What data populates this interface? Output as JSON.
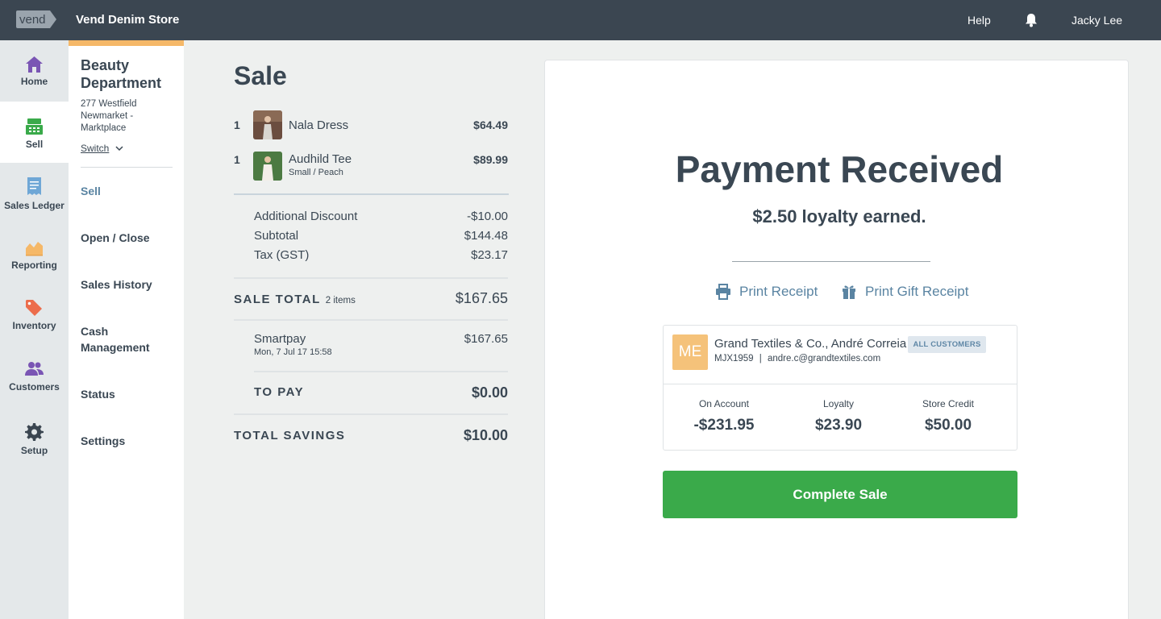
{
  "topbar": {
    "logo_text": "vend",
    "store_name": "Vend Denim Store",
    "help_label": "Help",
    "user_name": "Jacky Lee"
  },
  "nav": {
    "items": [
      {
        "label": "Home",
        "icon": "home-icon",
        "color": "#7a55b4"
      },
      {
        "label": "Sell",
        "icon": "register-icon",
        "color": "#3aaa4a"
      },
      {
        "label": "Sales Ledger",
        "icon": "ledger-icon",
        "color": "#6fa7d6"
      },
      {
        "label": "Reporting",
        "icon": "chart-icon",
        "color": "#f5b868"
      },
      {
        "label": "Inventory",
        "icon": "tag-icon",
        "color": "#ec6d4c"
      },
      {
        "label": "Customers",
        "icon": "people-icon",
        "color": "#7a55b4"
      },
      {
        "label": "Setup",
        "icon": "gear-icon",
        "color": "#3b4651"
      }
    ]
  },
  "dept": {
    "title": "Beauty Department",
    "address": "277 Westfield Newmarket - Marktplace",
    "switch_label": "Switch",
    "menu": [
      "Sell",
      "Open / Close",
      "Sales History",
      "Cash Management",
      "Status",
      "Settings"
    ]
  },
  "sale": {
    "title": "Sale",
    "items": [
      {
        "qty": "1",
        "name": "Nala Dress",
        "variant": "",
        "price": "$64.49"
      },
      {
        "qty": "1",
        "name": "Audhild Tee",
        "variant": "Small / Peach",
        "price": "$89.99"
      }
    ],
    "discount_label": "Additional Discount",
    "discount_value": "-$10.00",
    "subtotal_label": "Subtotal",
    "subtotal_value": "$144.48",
    "tax_label": "Tax (GST)",
    "tax_value": "$23.17",
    "total_label": "SALE TOTAL",
    "total_items": "2 items",
    "total_value": "$167.65",
    "payment_method": "Smartpay",
    "payment_date": "Mon, 7 Jul 17 15:58",
    "payment_value": "$167.65",
    "to_pay_label": "TO PAY",
    "to_pay_value": "$0.00",
    "savings_label": "TOTAL SAVINGS",
    "savings_value": "$10.00"
  },
  "payment": {
    "title": "Payment Received",
    "loyalty_earned": "$2.50 loyalty earned.",
    "print_receipt": "Print Receipt",
    "print_gift_receipt": "Print Gift Receipt",
    "complete_label": "Complete Sale",
    "accent_color": "#3aaa4a",
    "link_color": "#5a84a2"
  },
  "customer": {
    "initials": "ME",
    "name": "Grand Textiles & Co., André Correia",
    "group_badge": "ALL CUSTOMERS",
    "code": "MJX1959",
    "email": "andre.c@grandtextiles.com",
    "stats": [
      {
        "label": "On Account",
        "value": "-$231.95"
      },
      {
        "label": "Loyalty",
        "value": "$23.90"
      },
      {
        "label": "Store Credit",
        "value": "$50.00"
      }
    ]
  }
}
